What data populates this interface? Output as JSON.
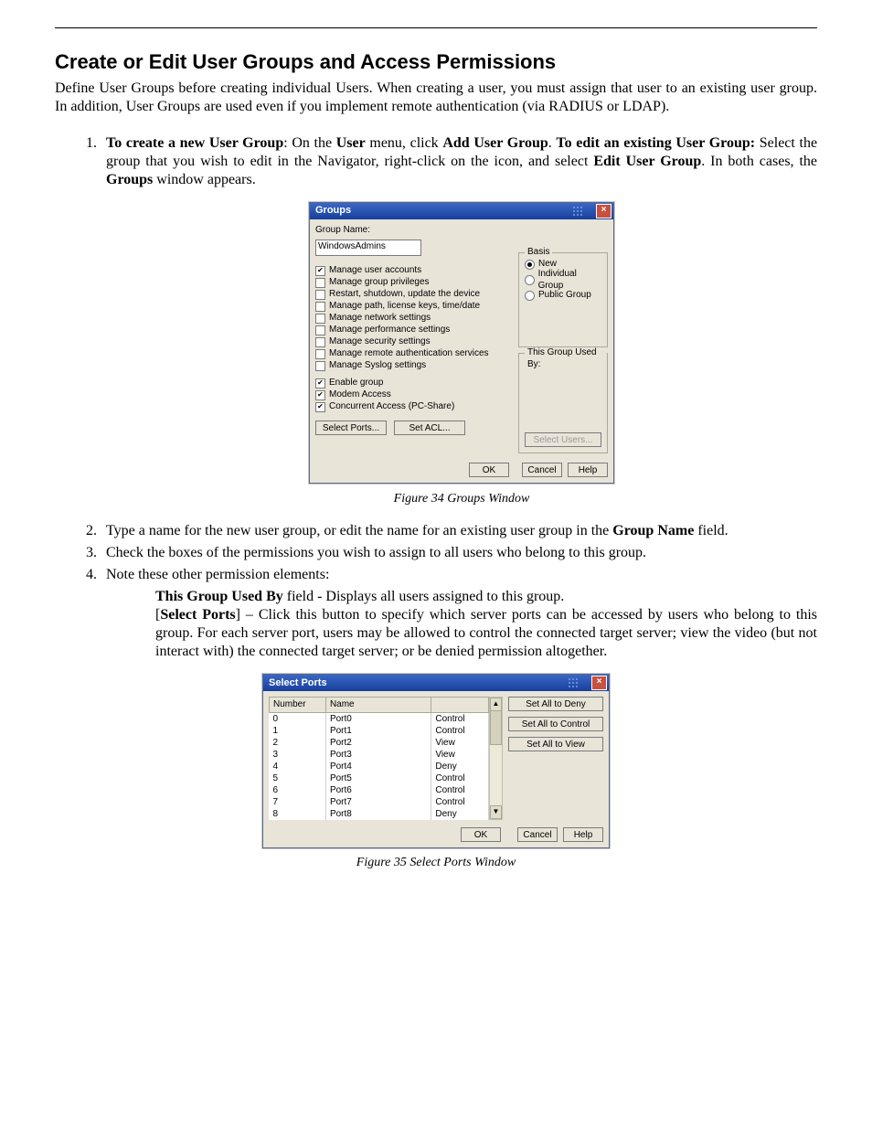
{
  "heading": "Create or Edit User Groups and Access Permissions",
  "intro": "Define User Groups before creating individual Users. When creating a user, you must assign that user to an existing user group. In addition, User Groups are used even if you implement remote authentication (via RADIUS or LDAP).",
  "step1": {
    "lead": "To create a new User Group",
    "mid1": ": On the ",
    "user": "User",
    "mid2": " menu, click ",
    "addug": "Add User Group",
    "mid3": ". ",
    "edit_lead": "To edit an existing User Group:",
    "tail1": " Select the group that you wish to edit in the Navigator, right-click on the icon, and select ",
    "editug": "Edit User Group",
    "tail2": ". In both cases, the ",
    "groups": "Groups",
    "tail3": " window appears."
  },
  "figure1_caption": "Figure 34 Groups Window",
  "step2": {
    "pre": "Type a name for the new user group, or edit the name for an existing user group in the ",
    "bold": "Group Name",
    "post": " field."
  },
  "step3": "Check the boxes of the permissions you wish to assign to all users who belong to this group.",
  "step4": "Note these other permission elements:",
  "sub_used_by": {
    "bold": "This Group Used By",
    "rest": " field - Displays all users assigned to this group."
  },
  "sub_select_ports": {
    "open": "[",
    "bold": "Select Ports",
    "close": "]",
    "rest": " – Click this button to specify which server ports can be accessed by users who belong to this group. For each server port, users may be allowed to control the connected target server; view the video (but not interact with) the connected target server; or be denied permission altogether."
  },
  "figure2_caption": "Figure 35 Select Ports Window",
  "groups_dialog": {
    "title": "Groups",
    "group_name_label": "Group Name:",
    "group_name_value": "WindowsAdmins",
    "permissions": [
      {
        "label": "Manage user accounts",
        "checked": true
      },
      {
        "label": "Manage group privileges",
        "checked": false
      },
      {
        "label": "Restart, shutdown, update the device",
        "checked": false
      },
      {
        "label": "Manage path, license keys, time/date",
        "checked": false
      },
      {
        "label": "Manage network settings",
        "checked": false
      },
      {
        "label": "Manage performance settings",
        "checked": false
      },
      {
        "label": "Manage security settings",
        "checked": false
      },
      {
        "label": "Manage remote authentication services",
        "checked": false
      },
      {
        "label": "Manage Syslog settings",
        "checked": false
      }
    ],
    "options": [
      {
        "label": "Enable group",
        "checked": true
      },
      {
        "label": "Modem Access",
        "checked": true
      },
      {
        "label": "Concurrent Access (PC-Share)",
        "checked": true
      }
    ],
    "select_ports_btn": "Select Ports...",
    "set_acl_btn": "Set ACL...",
    "basis_legend": "Basis",
    "basis": [
      {
        "label": "New",
        "checked": true
      },
      {
        "label": "Individual Group",
        "checked": false
      },
      {
        "label": "Public Group",
        "checked": false
      }
    ],
    "this_group_legend": "This Group Used By:",
    "select_users_btn": "Select Users...",
    "ok": "OK",
    "cancel": "Cancel",
    "help": "Help"
  },
  "ports_dialog": {
    "title": "Select Ports",
    "col_number": "Number",
    "col_name": "Name",
    "col_mode": "",
    "rows": [
      {
        "n": "0",
        "name": "Port0",
        "mode": "Control"
      },
      {
        "n": "1",
        "name": "Port1",
        "mode": "Control"
      },
      {
        "n": "2",
        "name": "Port2",
        "mode": "View"
      },
      {
        "n": "3",
        "name": "Port3",
        "mode": "View"
      },
      {
        "n": "4",
        "name": "Port4",
        "mode": "Deny"
      },
      {
        "n": "5",
        "name": "Port5",
        "mode": "Control"
      },
      {
        "n": "6",
        "name": "Port6",
        "mode": "Control"
      },
      {
        "n": "7",
        "name": "Port7",
        "mode": "Control"
      },
      {
        "n": "8",
        "name": "Port8",
        "mode": "Deny"
      }
    ],
    "set_deny": "Set All to Deny",
    "set_control": "Set All to Control",
    "set_view": "Set All to View",
    "ok": "OK",
    "cancel": "Cancel",
    "help": "Help"
  }
}
